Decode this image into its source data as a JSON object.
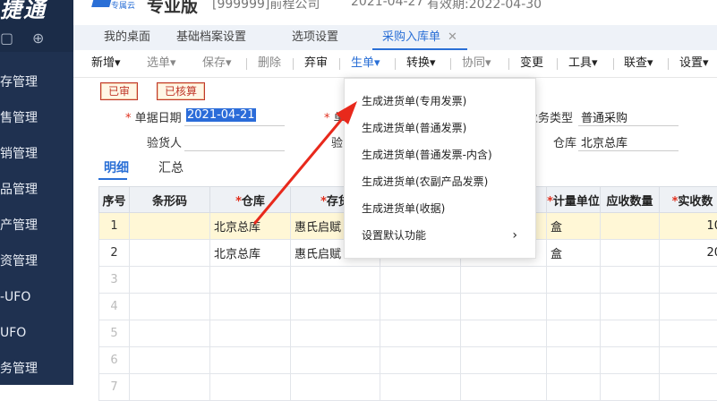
{
  "sidebar": {
    "logo": "捷通",
    "top_icons": [
      "monitor-icon",
      "plus-square-icon"
    ],
    "items": [
      {
        "label": "存管理"
      },
      {
        "label": "售管理"
      },
      {
        "label": "销管理"
      },
      {
        "label": "品管理"
      },
      {
        "label": "产管理"
      },
      {
        "label": "资管理"
      },
      {
        "label": "-UFO"
      },
      {
        "label": "UFO"
      },
      {
        "label": "务管理"
      }
    ]
  },
  "header": {
    "brand_small": "专属云",
    "brand_name": "专业版",
    "company": "[999999]前程公司",
    "date": "2021-04-27",
    "expiry": "有效期:2022-04-30"
  },
  "tabs": [
    {
      "label": "我的桌面"
    },
    {
      "label": "基础档案设置"
    },
    {
      "label": "选项设置"
    },
    {
      "label": "采购入库单",
      "close": "✕"
    }
  ],
  "toolbar": {
    "add": "新增",
    "select": "选单",
    "save": "保存",
    "delete": "删除",
    "unaudit": "弃审",
    "generate": "生单",
    "convert": "转换",
    "collaborate": "协同",
    "change": "变更",
    "tools": "工具",
    "link": "联查",
    "settings": "设置",
    "caret": "▾"
  },
  "stamps": {
    "audited": "已审",
    "verified": "已核算"
  },
  "form": {
    "date_label": "单据日期",
    "date_value": "2021-04-21",
    "inspector_label": "验货人",
    "hidden_label_1": "单",
    "hidden_label_2": "验",
    "biz_type_label": "业务类型",
    "biz_type_value": "普通采购",
    "warehouse_label": "仓库",
    "warehouse_value": "北京总库"
  },
  "subtabs": {
    "detail": "明细",
    "summary": "汇总"
  },
  "table": {
    "columns": [
      "序号",
      "条形码",
      "仓库",
      "存货",
      "",
      "",
      "计量单位",
      "应收数量",
      "实收数"
    ],
    "required_cols": [
      2,
      3,
      6,
      8
    ],
    "rows": [
      {
        "no": "1",
        "barcode": "",
        "warehouse": "北京总库",
        "item": "惠氏启赋",
        "unit": "盒",
        "qty_due": "",
        "qty": "10"
      },
      {
        "no": "2",
        "barcode": "",
        "warehouse": "北京总库",
        "item": "惠氏启赋",
        "unit": "盒",
        "qty_due": "",
        "qty": "20"
      },
      {
        "no": "3"
      },
      {
        "no": "4"
      },
      {
        "no": "5"
      },
      {
        "no": "6"
      },
      {
        "no": "7"
      }
    ]
  },
  "dropdown": {
    "items": [
      {
        "label": "生成进货单(专用发票)"
      },
      {
        "label": "生成进货单(普通发票)"
      },
      {
        "label": "生成进货单(普通发票-内含)"
      },
      {
        "label": "生成进货单(农副产品发票)"
      },
      {
        "label": "生成进货单(收据)"
      },
      {
        "label": "设置默认功能",
        "arrow": "›"
      }
    ]
  },
  "colors": {
    "accent": "#2a6fd6",
    "sidebar": "#1f3150",
    "arrow": "#e8291c",
    "stamp": "#c0392b"
  }
}
